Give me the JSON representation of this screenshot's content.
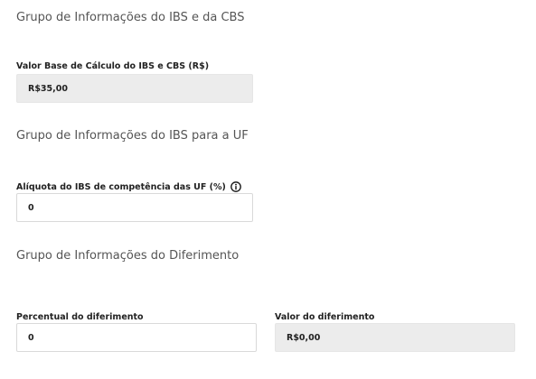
{
  "sections": {
    "ibs_cbs": {
      "title": "Grupo de Informações do IBS e da CBS",
      "base_label": "Valor Base de Cálculo do IBS e CBS (R$)",
      "base_value": "R$35,00"
    },
    "ibs_uf": {
      "title": "Grupo de Informações do IBS para a UF",
      "aliquota_label": "Alíquota do IBS de competência das UF (%)",
      "aliquota_value": "0",
      "info_icon": "info-circle-icon"
    },
    "diferimento": {
      "title": "Grupo de Informações do Diferimento",
      "percentual_label": "Percentual do diferimento",
      "percentual_value": "0",
      "valor_label": "Valor do diferimento",
      "valor_value": "R$0,00"
    }
  },
  "colors": {
    "readonly_bg": "#ececec",
    "border": "#d9d9d9",
    "title_text": "#555555",
    "label_text": "#222222"
  }
}
